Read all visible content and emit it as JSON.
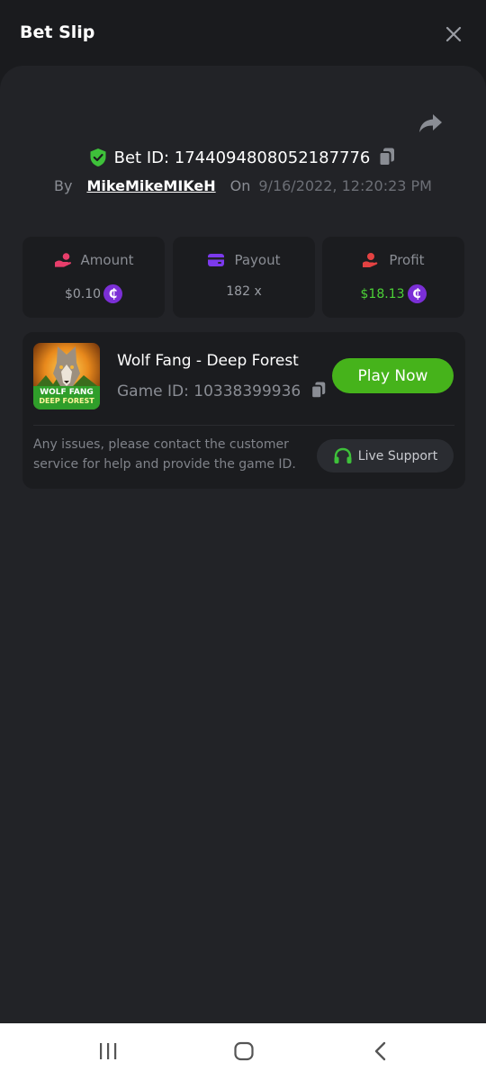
{
  "header": {
    "title": "Bet Slip",
    "close_icon": "close-icon"
  },
  "bet": {
    "id_label": "Bet ID: 1744094808052187776",
    "by_label": "By",
    "username": "MikeMikeMIKeH",
    "on_label": "On",
    "date": "9/16/2022, 12:20:23 PM"
  },
  "stats": [
    {
      "label": "Amount",
      "value": "$0.10",
      "icon": "amount-icon",
      "has_coin": true
    },
    {
      "label": "Payout",
      "value": "182 x",
      "icon": "wallet-icon",
      "has_coin": false
    },
    {
      "label": "Profit",
      "value": "$18.13",
      "icon": "profit-hand-icon",
      "has_coin": true
    }
  ],
  "coin_symbol": "₵",
  "game": {
    "title": "Wolf Fang - Deep Forest",
    "id_label": "Game ID: 10338399936",
    "thumb_line1": "WOLF FANG",
    "thumb_line2": "DEEP FOREST",
    "play_label": "Play Now",
    "issues_text": "Any issues, please contact the customer service for help and provide the game ID.",
    "support_label": "Live Support"
  },
  "colors": {
    "accent_green": "#46b31b",
    "profit_green": "#4cd137",
    "coin_purple": "#7b2fd6",
    "shield_green": "#3ec13a",
    "amount_pink": "#e83e6b",
    "wallet_purple": "#7c3aed",
    "profit_red": "#e34242"
  },
  "navbar": {
    "recents_icon": "recents-icon",
    "home_icon": "home-icon",
    "back_icon": "back-icon"
  }
}
